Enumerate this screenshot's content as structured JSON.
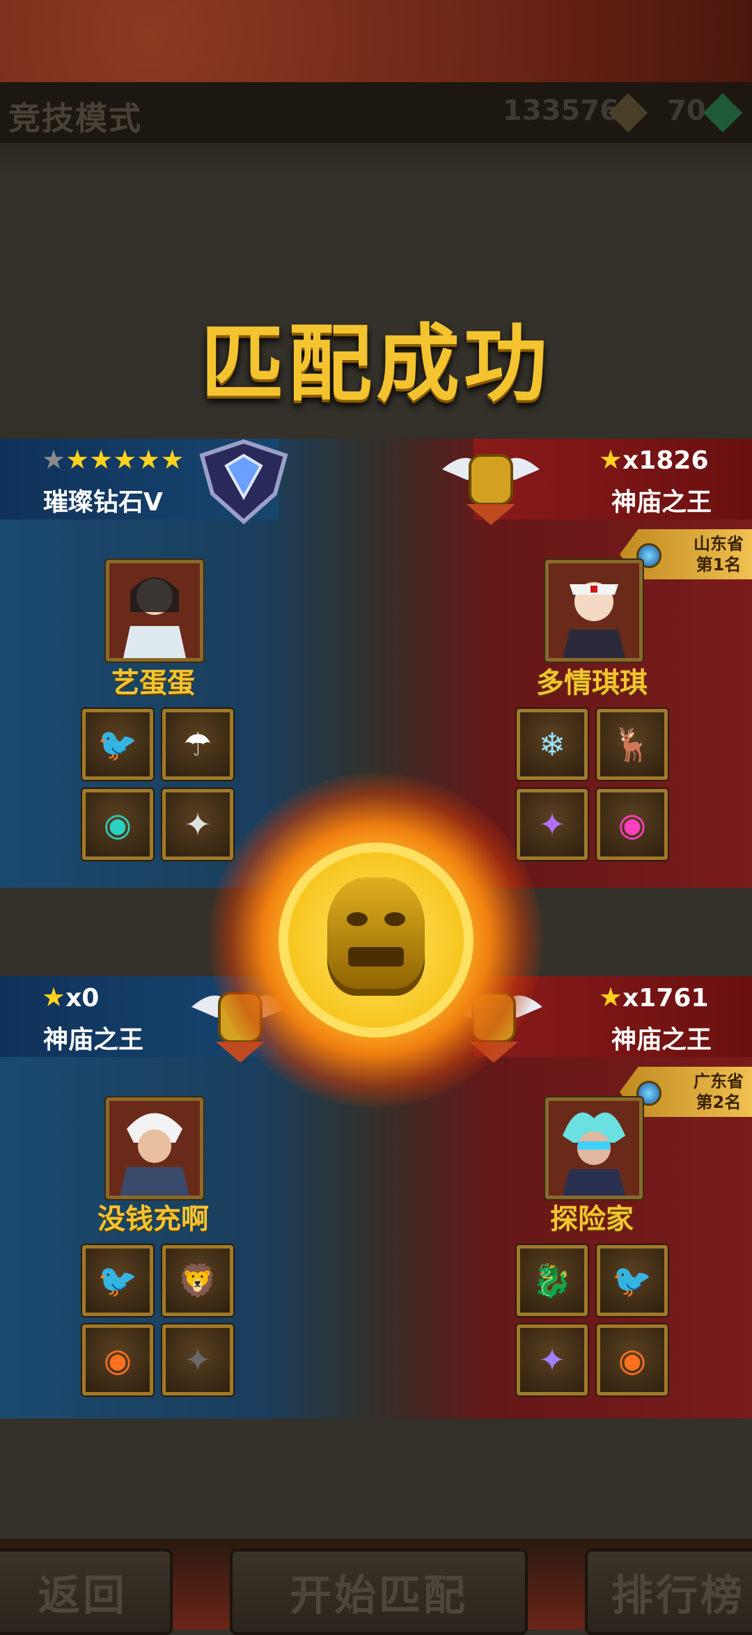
{
  "header": {
    "mode_title": "竞技模式",
    "gold_amount": "133576",
    "gem_amount": "70"
  },
  "main_title": "匹配成功",
  "team1": {
    "left": {
      "rank_name": "璀璨钻石V",
      "stars_filled": 5,
      "stars_total": 6,
      "player_name": "艺蛋蛋",
      "items": [
        "pink-bird-hat-icon",
        "leaf-umbrella-icon",
        "teal-orb-icon",
        "silver-wings-icon"
      ]
    },
    "right": {
      "star_count": "x1826",
      "rank_name": "神庙之王",
      "region": "山东省",
      "region_rank": "第1名",
      "player_name": "多情琪琪",
      "items": [
        "ice-spirit-icon",
        "white-deer-icon",
        "purple-wings-icon",
        "pink-orb-icon"
      ]
    }
  },
  "team2": {
    "left": {
      "star_count": "x0",
      "rank_name": "神庙之王",
      "player_name": "没钱充啊",
      "items": [
        "pink-bird-hat-icon",
        "red-lion-pet-icon",
        "fire-lion-orb-icon",
        "dark-wings-icon"
      ]
    },
    "right": {
      "star_count": "x1761",
      "rank_name": "神庙之王",
      "region": "广东省",
      "region_rank": "第2名",
      "player_name": "探险家",
      "items": [
        "golden-dragon-icon",
        "pink-bird-hat-icon",
        "violet-wings-icon",
        "fire-lion-orb-icon"
      ]
    }
  },
  "buttons": {
    "back": "返回",
    "start_match": "开始匹配",
    "leaderboard": "排行榜"
  },
  "colors": {
    "title_gold": "#f4c430",
    "team_blue": "#1a3e5c",
    "team_red": "#651818"
  }
}
